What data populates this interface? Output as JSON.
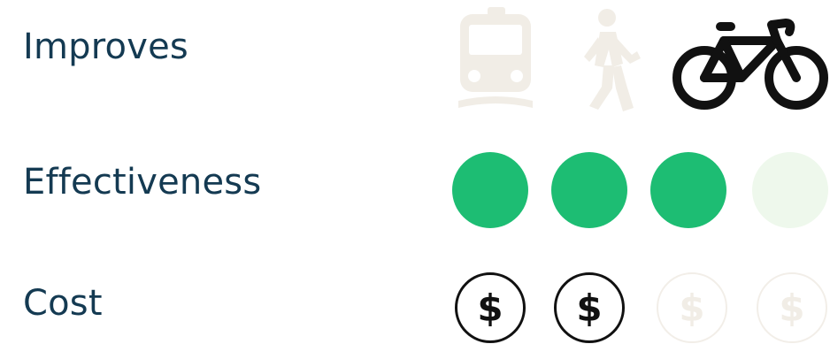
{
  "rows": {
    "improves": {
      "label": "Improves"
    },
    "effectiveness": {
      "label": "Effectiveness"
    },
    "cost": {
      "label": "Cost"
    }
  },
  "modes": [
    {
      "icon": "train-icon",
      "active": false
    },
    {
      "icon": "pedestrian-icon",
      "active": false
    },
    {
      "icon": "bicycle-icon",
      "active": true
    }
  ],
  "effectiveness_rating": {
    "value": 3,
    "max": 4
  },
  "cost_rating": {
    "value": 2,
    "max": 4,
    "symbol": "$"
  },
  "colors": {
    "label": "#143a52",
    "active_green": "#1dbd73",
    "inactive_green": "#eef8ec",
    "inactive_icon": "#f1ede6",
    "active_icon": "#111111"
  }
}
